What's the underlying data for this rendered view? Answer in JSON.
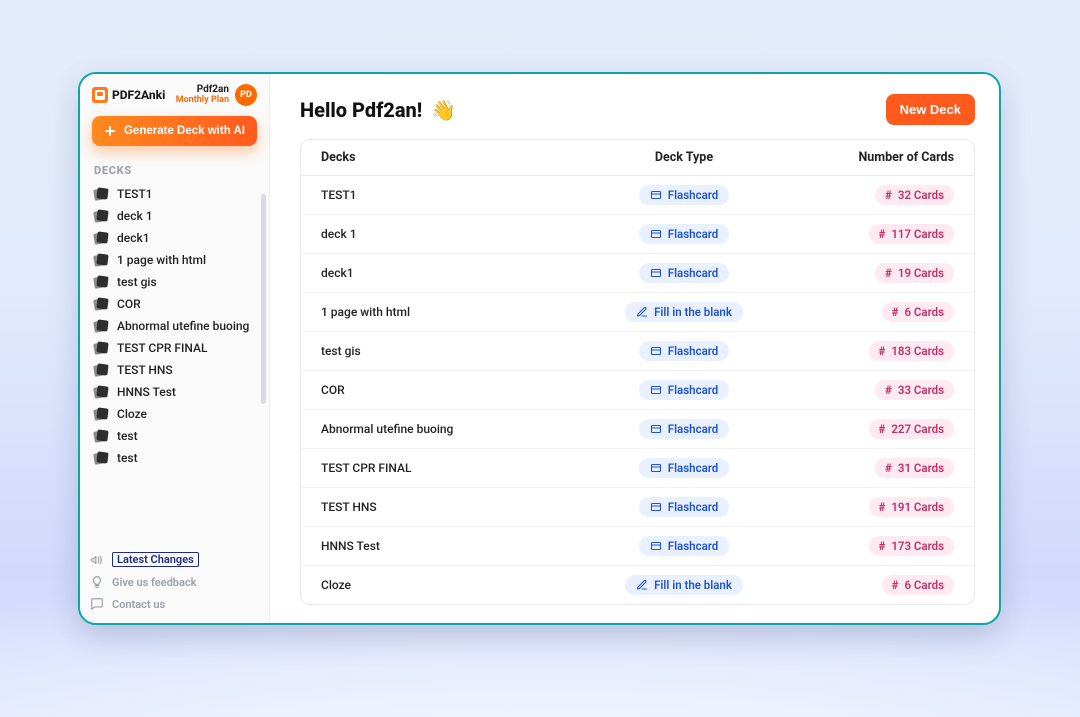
{
  "brand": {
    "name": "PDF2Anki"
  },
  "user": {
    "name": "Pdf2an",
    "plan": "Monthly Plan",
    "initials": "PD"
  },
  "sidebar": {
    "generate_label": "Generate Deck with AI",
    "decks_heading": "DECKS",
    "items": [
      {
        "label": "TEST1"
      },
      {
        "label": "deck 1"
      },
      {
        "label": "deck1"
      },
      {
        "label": "1 page with html"
      },
      {
        "label": "test gis"
      },
      {
        "label": "COR"
      },
      {
        "label": "Abnormal utefine buoing"
      },
      {
        "label": "TEST CPR FINAL"
      },
      {
        "label": "TEST HNS"
      },
      {
        "label": "HNNS Test"
      },
      {
        "label": "Cloze"
      },
      {
        "label": "test"
      },
      {
        "label": "test"
      }
    ],
    "footer": {
      "changes": "Latest Changes",
      "feedback": "Give us feedback",
      "contact": "Contact us"
    }
  },
  "main": {
    "greeting": "Hello Pdf2an!",
    "wave": "👋",
    "new_deck_label": "New Deck",
    "columns": {
      "name": "Decks",
      "type": "Deck Type",
      "count": "Number of Cards"
    },
    "type_labels": {
      "flashcard": "Flashcard",
      "fill": "Fill in the blank"
    },
    "cards_suffix": "Cards",
    "rows": [
      {
        "name": "TEST1",
        "type": "flashcard",
        "count": 32
      },
      {
        "name": "deck 1",
        "type": "flashcard",
        "count": 117
      },
      {
        "name": "deck1",
        "type": "flashcard",
        "count": 19
      },
      {
        "name": "1 page with html",
        "type": "fill",
        "count": 6
      },
      {
        "name": "test gis",
        "type": "flashcard",
        "count": 183
      },
      {
        "name": "COR",
        "type": "flashcard",
        "count": 33
      },
      {
        "name": "Abnormal utefine buoing",
        "type": "flashcard",
        "count": 227
      },
      {
        "name": "TEST CPR FINAL",
        "type": "flashcard",
        "count": 31
      },
      {
        "name": "TEST HNS",
        "type": "flashcard",
        "count": 191
      },
      {
        "name": "HNNS Test",
        "type": "flashcard",
        "count": 173
      },
      {
        "name": "Cloze",
        "type": "fill",
        "count": 6
      }
    ]
  }
}
